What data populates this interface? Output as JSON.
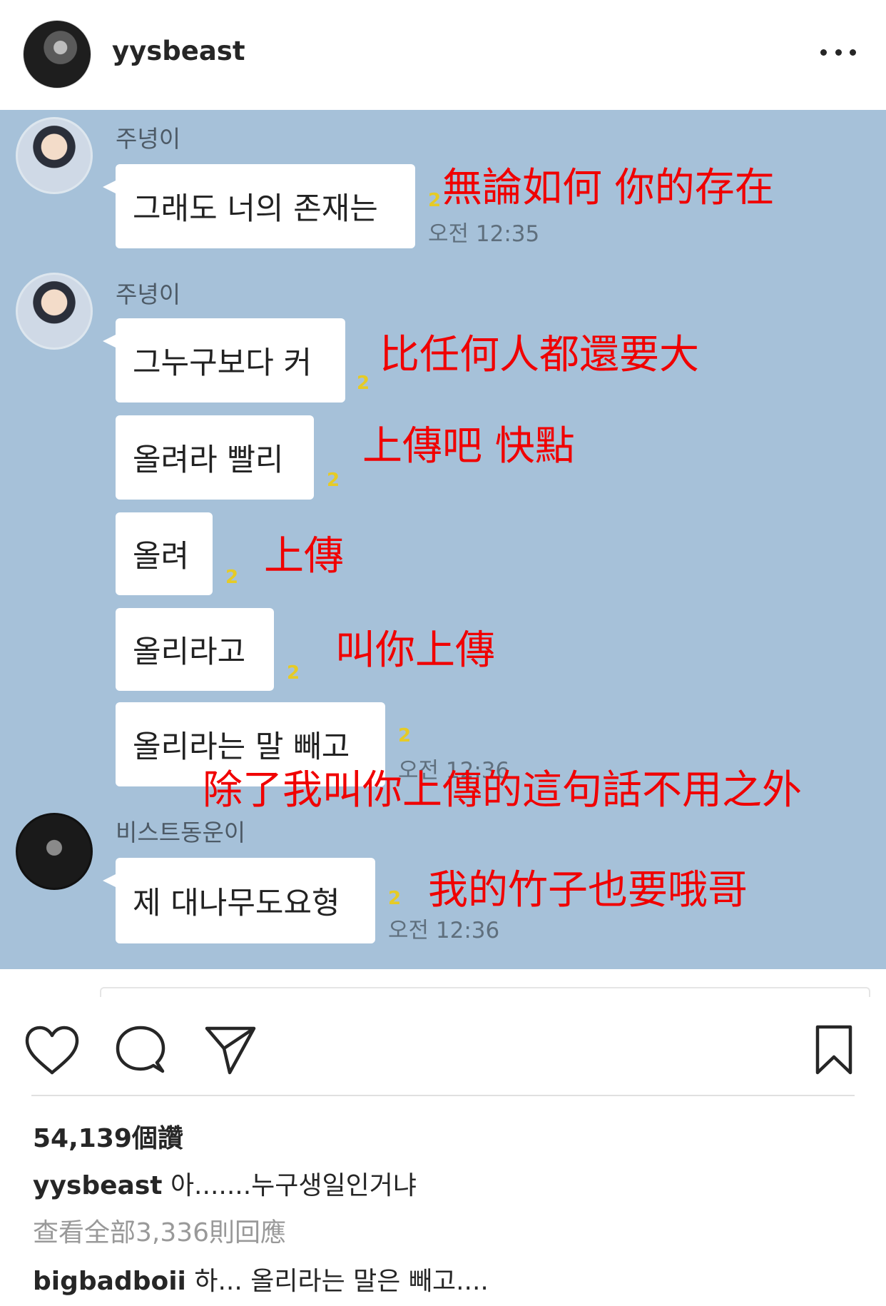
{
  "post": {
    "username": "yysbeast",
    "likes": "54,139個讚",
    "caption_user": "yysbeast",
    "caption_text": "아.......누구생일인거냐",
    "view_all_comments": "查看全部3,336則回應",
    "comment_user": "bigbadboii",
    "comment_text": "하... 올리라는 말은 빼고...."
  },
  "chat": {
    "messages": [
      {
        "sender": "주녕이",
        "text": "그래도 너의 존재는",
        "unread": "2",
        "time": "오전 12:35",
        "translation": "無論如何 你的存在"
      },
      {
        "sender": "주녕이",
        "text": "그누구보다 커",
        "unread": "2",
        "translation": "比任何人都還要大"
      },
      {
        "text": "올려라 빨리",
        "unread": "2",
        "translation": "上傳吧 快點"
      },
      {
        "text": "올려",
        "unread": "2",
        "translation": "上傳"
      },
      {
        "text": "올리라고",
        "unread": "2",
        "translation": "叫你上傳"
      },
      {
        "text": "올리라는 말 빼고",
        "unread": "2",
        "time": "오전 12:36",
        "translation": "除了我叫你上傳的這句話不用之外"
      },
      {
        "sender": "비스트동운이",
        "text": "제 대나무도요형",
        "unread": "2",
        "time": "오전 12:36",
        "translation": "我的竹子也要哦哥"
      }
    ]
  },
  "icons": {
    "more": "more-options-icon",
    "like": "heart-icon",
    "comment": "comment-bubble-icon",
    "share": "paper-plane-icon",
    "save": "bookmark-icon"
  },
  "colors": {
    "chat_background": "#a6c1d9",
    "translation": "#f00000",
    "unread": "#e6cb25"
  }
}
